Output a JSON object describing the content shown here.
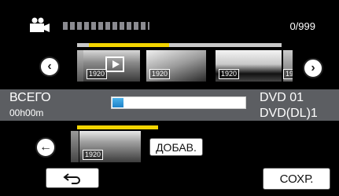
{
  "header": {
    "mode_icon": "movie-camera-icon",
    "counter": "0/999"
  },
  "filmstrip_top": {
    "prev_icon": "chevron-left-icon",
    "next_icon": "chevron-right-icon",
    "thumbnails": [
      {
        "resolution": "1920",
        "selected": true
      },
      {
        "resolution": "1920"
      },
      {
        "resolution": "1920"
      },
      {
        "resolution": "19"
      }
    ],
    "position_fraction": 0.39
  },
  "summary": {
    "total_label": "ВСЕГО",
    "total_time": "00h00m",
    "disc_line1": "DVD  01",
    "disc_line2": "DVD(DL)1",
    "capacity_fraction": 0.08,
    "capacity_color": "#1e82c8"
  },
  "filmstrip_bottom": {
    "back_icon": "arrow-left-circle-icon",
    "thumbnails": [
      {
        "resolution": "1920"
      }
    ],
    "add_label": "ДОБАВ."
  },
  "footer": {
    "return_icon": "return-arrow-icon",
    "save_label": "СОХР."
  },
  "colors": {
    "progress": "#f2d400",
    "band": "#5c5e62"
  }
}
